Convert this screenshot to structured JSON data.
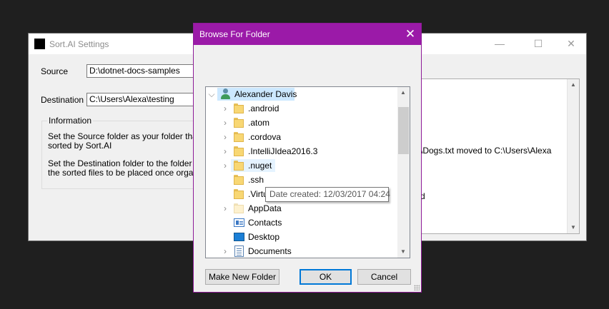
{
  "main_window": {
    "title": "Sort.AI Settings",
    "window_buttons": {
      "minimize": "—",
      "maximize": "☐",
      "close": "✕"
    },
    "source_label": "Source",
    "source_value": "D:\\dotnet-docs-samples",
    "destination_label": "Destination",
    "destination_value": "C:\\Users\\Alexa\\testing",
    "info_group_title": "Information",
    "info_text_1_line1": "Set the Source folder as your folder that nee",
    "info_text_1_line2": "sorted by Sort.AI",
    "info_text_2_line1": "Set the Destination folder to the folder you w",
    "info_text_2_line2": "the sorted files to be placed once organised",
    "log_line_1": "\\Dogs.txt moved to C:\\Users\\Alexa",
    "log_line_2": "d"
  },
  "dialog": {
    "title": "Browse For Folder",
    "close_glyph": "✕",
    "tree": {
      "root": {
        "label": "Alexander Davis",
        "expander": "⌵",
        "icon": "user-icon"
      },
      "items": [
        {
          "label": ".android",
          "expander": "›",
          "icon": "folder-icon"
        },
        {
          "label": ".atom",
          "expander": "›",
          "icon": "folder-icon"
        },
        {
          "label": ".cordova",
          "expander": "›",
          "icon": "folder-icon"
        },
        {
          "label": ".IntelliJIdea2016.3",
          "expander": "›",
          "icon": "folder-icon"
        },
        {
          "label": ".nuget",
          "expander": "›",
          "icon": "folder-icon"
        },
        {
          "label": ".ssh",
          "expander": "",
          "icon": "folder-icon"
        },
        {
          "label": ".Virtu",
          "expander": "",
          "icon": "folder-icon"
        },
        {
          "label": "AppData",
          "expander": "›",
          "icon": "folder-icon"
        },
        {
          "label": "Contacts",
          "expander": "",
          "icon": "contacts-icon"
        },
        {
          "label": "Desktop",
          "expander": "",
          "icon": "desktop-icon"
        },
        {
          "label": "Documents",
          "expander": "›",
          "icon": "documents-icon"
        }
      ],
      "scroll_up": "▲",
      "scroll_down": "▼"
    },
    "tooltip": "Date created: 12/03/2017 04:24",
    "buttons": {
      "new_folder": "Make New Folder",
      "ok": "OK",
      "cancel": "Cancel"
    }
  },
  "colors": {
    "dialog_title_bar": "#9b1aa8",
    "selection": "#cce8ff",
    "default_button_border": "#0078d7"
  }
}
